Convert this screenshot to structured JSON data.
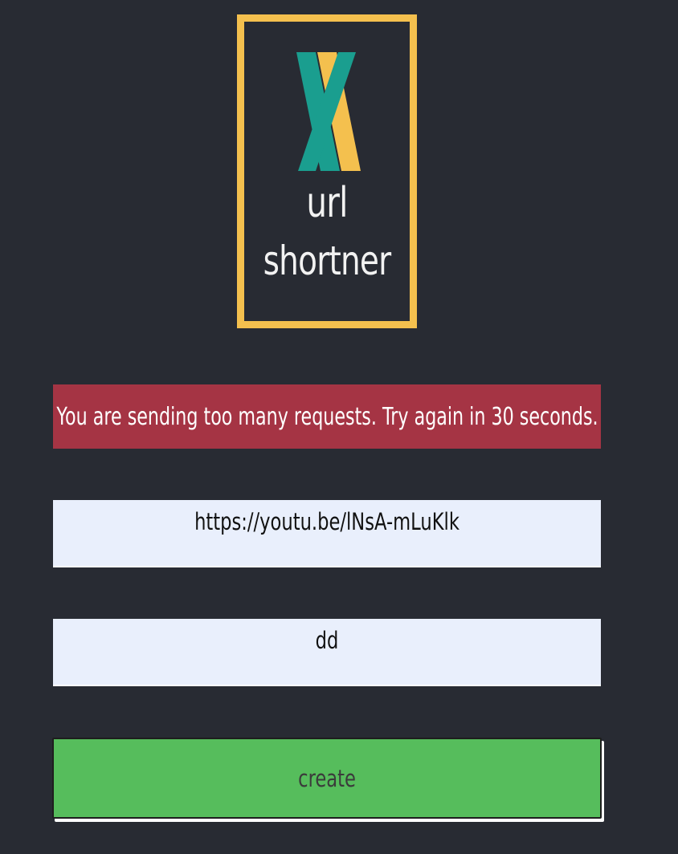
{
  "logo": {
    "line1": "url",
    "line2": "shortner",
    "border_color": "#f4c04e",
    "x_teal": "#1a9e8f",
    "x_yellow": "#f4c04e"
  },
  "alert": {
    "message": "You are sending too many requests. Try again in 30 seconds.",
    "color": "#a53444"
  },
  "form": {
    "url_value": "https://youtu.be/lNsA-mLuKlk",
    "alias_value": "dd",
    "field_bg": "#e9effc",
    "create_label": "create",
    "create_color": "#56bd5c"
  },
  "page": {
    "background": "#282b33"
  }
}
